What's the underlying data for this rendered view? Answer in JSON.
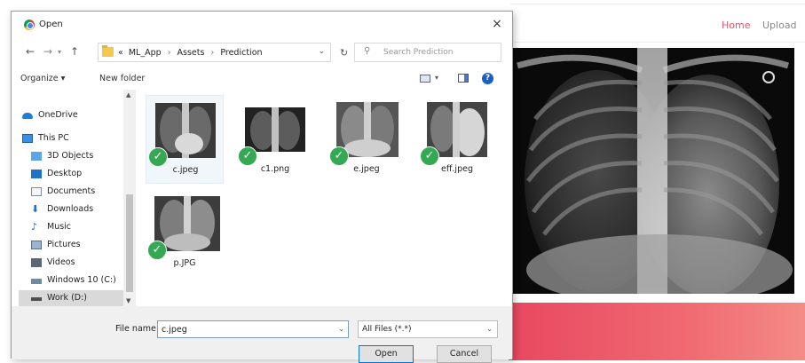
{
  "web": {
    "nav": {
      "home": "Home",
      "upload": "Upload"
    },
    "colors": {
      "accent": "#e8546b",
      "banner": "#ef6270"
    }
  },
  "dialog": {
    "title": "Open",
    "close_icon": "×",
    "address": {
      "crumbs": [
        "«",
        "ML_App",
        "›",
        "Assets",
        "›",
        "Prediction"
      ]
    },
    "search": {
      "placeholder": "Search Prediction"
    },
    "toolbar": {
      "organize": "Organize ▾",
      "new_folder": "New folder",
      "help": "?"
    },
    "nav_items": [
      {
        "label": "OneDrive",
        "icon": "cloud-icon"
      },
      {
        "label": "This PC",
        "icon": "computer-icon"
      },
      {
        "label": "3D Objects",
        "icon": "3d-objects-icon"
      },
      {
        "label": "Desktop",
        "icon": "desktop-icon"
      },
      {
        "label": "Documents",
        "icon": "documents-icon"
      },
      {
        "label": "Downloads",
        "icon": "downloads-icon"
      },
      {
        "label": "Music",
        "icon": "music-icon"
      },
      {
        "label": "Pictures",
        "icon": "pictures-icon"
      },
      {
        "label": "Videos",
        "icon": "videos-icon"
      },
      {
        "label": "Windows 10 (C:)",
        "icon": "drive-c-icon"
      },
      {
        "label": "Work (D:)",
        "icon": "drive-d-icon",
        "selected": true
      }
    ],
    "files": [
      {
        "name": "c.jpeg",
        "selected": true,
        "synced": true
      },
      {
        "name": "c1.png",
        "selected": false,
        "synced": true
      },
      {
        "name": "e.jpeg",
        "selected": false,
        "synced": true
      },
      {
        "name": "eff.jpeg",
        "selected": false,
        "synced": true
      },
      {
        "name": "p.JPG",
        "selected": false,
        "synced": true
      }
    ],
    "file_name": {
      "label": "File name:",
      "value": "c.jpeg"
    },
    "file_type": {
      "value": "All Files (*.*)"
    },
    "buttons": {
      "open": "Open",
      "cancel": "Cancel"
    }
  }
}
